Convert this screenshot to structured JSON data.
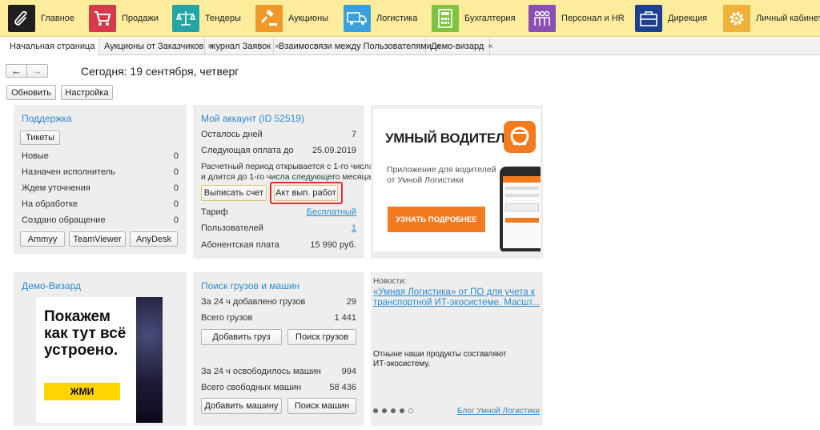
{
  "nav": [
    {
      "label": "Главное",
      "icon": "paperclip-icon",
      "color": "#1f1f1f"
    },
    {
      "label": "Продажи",
      "icon": "shopping-cart-icon",
      "color": "#d53b4a"
    },
    {
      "label": "Тендеры",
      "icon": "scales-icon",
      "color": "#23a5a6"
    },
    {
      "label": "Аукционы",
      "icon": "gavel-icon",
      "color": "#f0992a"
    },
    {
      "label": "Логистика",
      "icon": "truck-icon",
      "color": "#3a9fdd"
    },
    {
      "label": "Бухгалтерия",
      "icon": "calculator-icon",
      "color": "#7ec242"
    },
    {
      "label": "Персонал и HR",
      "icon": "people-icon",
      "color": "#8a4fb3"
    },
    {
      "label": "Дирекция",
      "icon": "briefcase-icon",
      "color": "#1d3f8f"
    },
    {
      "label": "Личный кабинет",
      "icon": "gear-icon",
      "color": "#f0b13a"
    }
  ],
  "tabs": [
    {
      "label": "Начальная страница",
      "icon": "home-icon"
    },
    {
      "label": "Аукционы от Заказчиков",
      "close": "×"
    },
    {
      "label": "журнал Заявок",
      "close": "×"
    },
    {
      "label": "Взаимосвязи между Пользователями",
      "close": "×"
    },
    {
      "label": "Демо-визард",
      "close": "×"
    }
  ],
  "toolbar": {
    "back": "←",
    "forward": "→",
    "today": "Сегодня: 19 сентября, четверг",
    "refresh": "Обновить",
    "settings": "Настройка"
  },
  "support": {
    "title": "Поддержка",
    "tickets_button": "Тикеты",
    "rows": [
      {
        "label": "Новые",
        "value": "0"
      },
      {
        "label": "Назначен исполнитель",
        "value": "0"
      },
      {
        "label": "Ждем уточнения",
        "value": "0"
      },
      {
        "label": "На обработке",
        "value": "0"
      },
      {
        "label": "Создано обращение",
        "value": "0"
      }
    ],
    "buttons": [
      "Ammyy",
      "TeamViewer",
      "AnyDesk"
    ]
  },
  "account": {
    "title": "Мой аккаунт (ID 52519)",
    "days_label": "Осталось дней",
    "days_value": "7",
    "next_label": "Следующая оплата до",
    "next_value": "25.09.2019",
    "note1": "Расчетный период открывается с 1-го числа",
    "note2": "и длится до 1-го числа следующего месяца.",
    "invoice_button": "Выписать счет",
    "act_button": "Акт вып. работ",
    "tariff_label": "Тариф",
    "tariff_value": "Бесплатный",
    "users_label": "Пользователей",
    "users_value": "1",
    "fee_label": "Абонентская плата",
    "fee_value": "15 990 руб."
  },
  "promo": {
    "title": "УМНЫЙ ВОДИТЕЛЬ",
    "subtitle1": "Приложение для водителей",
    "subtitle2": "от Умной Логистики",
    "cta": "УЗНАТЬ ПОДРОБНЕЕ"
  },
  "demo": {
    "title": "Демо-Визард",
    "line1": "Покажем",
    "line2": "как тут всё",
    "line3": "устроено.",
    "cta": "ЖМИ"
  },
  "cargo": {
    "title": "Поиск грузов и машин",
    "added_label": "За 24 ч добавлено грузов",
    "added_value": "29",
    "total_label": "Всего грузов",
    "total_value": "1 441",
    "add_cargo": "Добавить груз",
    "search_cargo": "Поиск грузов",
    "freed_label": "За 24 ч освободилось машин",
    "freed_value": "994",
    "free_label": "Всего свободных машин",
    "free_value": "58 436",
    "add_car": "Добавить машину",
    "search_car": "Поиск машин"
  },
  "news": {
    "label": "Новости:",
    "headline1": "«Умная Логистика» от ПО для учета к",
    "headline2": "транспортной ИТ-экосистеме. Масшт...",
    "body1": "Отныне наши продукты составляют",
    "body2": "ИТ-экосистему.",
    "blog_link": "Блог Умной Логистики",
    "dots": 5,
    "active_dot": 4
  },
  "colors": {
    "accent": "#2a89d0",
    "topbar": "#fcec9c",
    "panel": "#eeeeee",
    "orange": "#f47a20",
    "highlight": "#e03030"
  }
}
